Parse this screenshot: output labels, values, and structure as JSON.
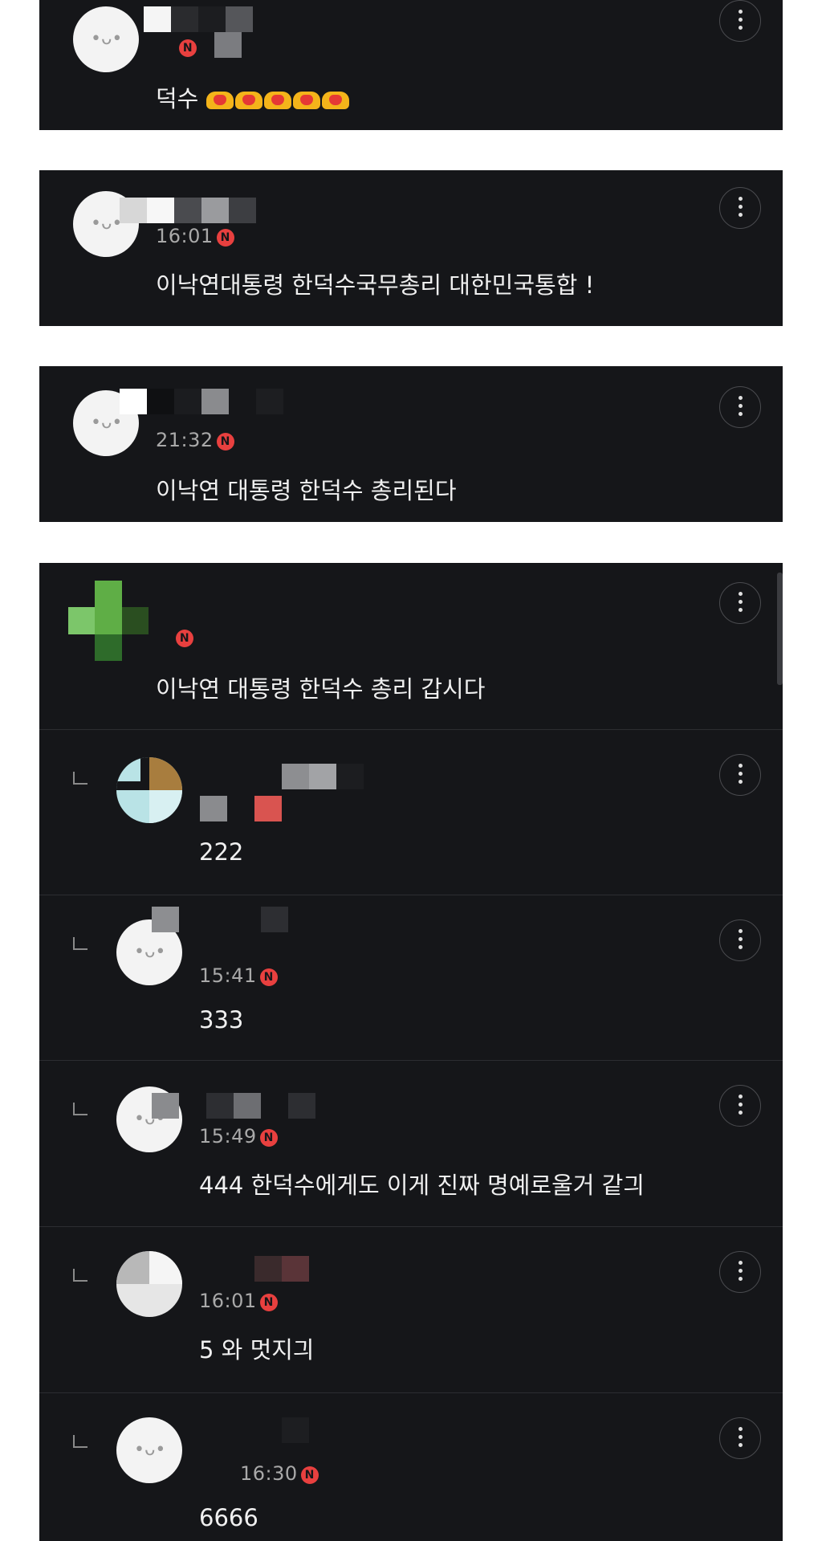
{
  "comments": [
    {
      "time": "",
      "text": "덕수",
      "emoji": "heart-hands x5"
    },
    {
      "time": "16:01",
      "text": "이낙연대통령 한덕수국무총리 대한민국통합 !"
    },
    {
      "time": "21:32",
      "text": "이낙연 대통령 한덕수 총리된다"
    },
    {
      "time": "",
      "text": "이낙연 대통령 한덕수 총리 갑시다"
    }
  ],
  "replies": [
    {
      "time": "",
      "text": "222"
    },
    {
      "time": "15:41",
      "text": "333"
    },
    {
      "time": "15:49",
      "text": "444 한덕수에게도 이게 진짜 명예로울거 같긔"
    },
    {
      "time": "16:01",
      "text": "5 와 멋지긔"
    },
    {
      "time": "16:30",
      "text": "6666"
    }
  ],
  "badge": "N",
  "colors": {
    "card_bg": "#151619",
    "badge": "#e8403f",
    "heart": "#f4b41a"
  }
}
